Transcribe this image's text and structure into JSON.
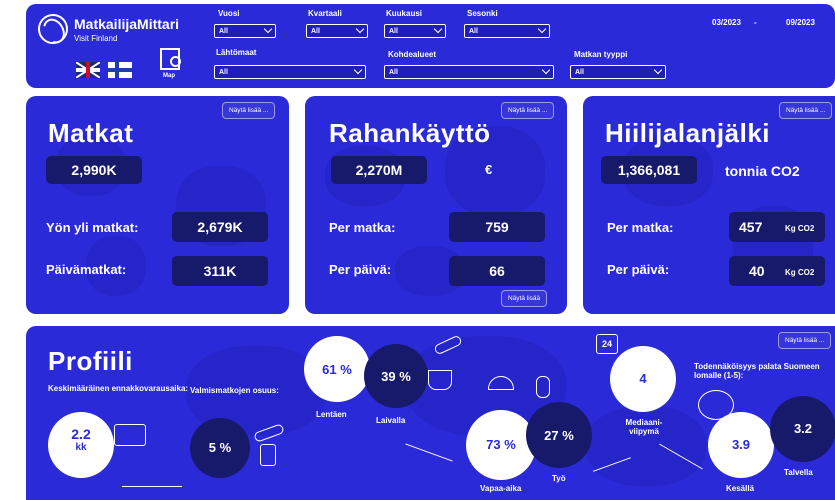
{
  "header": {
    "brand": "MatkailijaMittari",
    "brand_sub": "Visit Finland",
    "map_label": "Map",
    "filters": {
      "year": {
        "label": "Vuosi",
        "value": "All"
      },
      "quarter": {
        "label": "Kvartaali",
        "value": "All"
      },
      "month": {
        "label": "Kuukausi",
        "value": "All"
      },
      "season": {
        "label": "Sesonki",
        "value": "All"
      },
      "origin": {
        "label": "Lähtömaat",
        "value": "All"
      },
      "destination": {
        "label": "Kohdealueet",
        "value": "All"
      },
      "trip_type": {
        "label": "Matkan tyyppi",
        "value": "All"
      }
    },
    "date_start": "03/2023",
    "date_sep": "-",
    "date_end": "09/2023"
  },
  "trips": {
    "title": "Matkat",
    "more": "Näytä lisää ...",
    "total": "2,990K",
    "overnight_label": "Yön yli matkat:",
    "overnight_value": "2,679K",
    "day_label": "Päivämatkat:",
    "day_value": "311K"
  },
  "spending": {
    "title": "Rahankäyttö",
    "more": "Näytä lisää ...",
    "more_bottom": "Näytä lisää",
    "total": "2,270M",
    "currency": "€",
    "per_trip_label": "Per matka:",
    "per_trip_value": "759",
    "per_day_label": "Per päivä:",
    "per_day_value": "66"
  },
  "carbon": {
    "title": "Hiilijalanjälki",
    "more": "Näytä lisää ...",
    "total": "1,366,081",
    "unit": "tonnia CO2",
    "per_trip_label": "Per matka:",
    "per_trip_value": "457",
    "per_trip_unit": "Kg CO2",
    "per_day_label": "Per päivä:",
    "per_day_value": "40",
    "per_day_unit": "Kg CO2"
  },
  "profile": {
    "title": "Profiili",
    "more": "Näytä lisää ...",
    "booking_label": "Keskimääräinen ennakkovarausaika:",
    "booking_value": "2.2",
    "booking_unit": "kk",
    "package_label": "Valmismatkojen osuus:",
    "package_value": "5 %",
    "plane_value": "61 %",
    "plane_label": "Lentäen",
    "ship_value": "39 %",
    "ship_label": "Laivalla",
    "leisure_value": "73 %",
    "leisure_label": "Vapaa-aika",
    "work_value": "27 %",
    "work_label": "Työ",
    "calendar_num": "24",
    "median_value": "4",
    "median_label": "Mediaani-viipymä",
    "return_label": "Todennäköisyys palata Suomeen lomalle (1-5):",
    "summer_value": "3.9",
    "summer_label": "Kesällä",
    "winter_value": "3.2",
    "winter_label": "Talvella"
  },
  "colors": {
    "panel": "#2a2ad8",
    "pill": "#171a6b",
    "white": "#ffffff"
  }
}
